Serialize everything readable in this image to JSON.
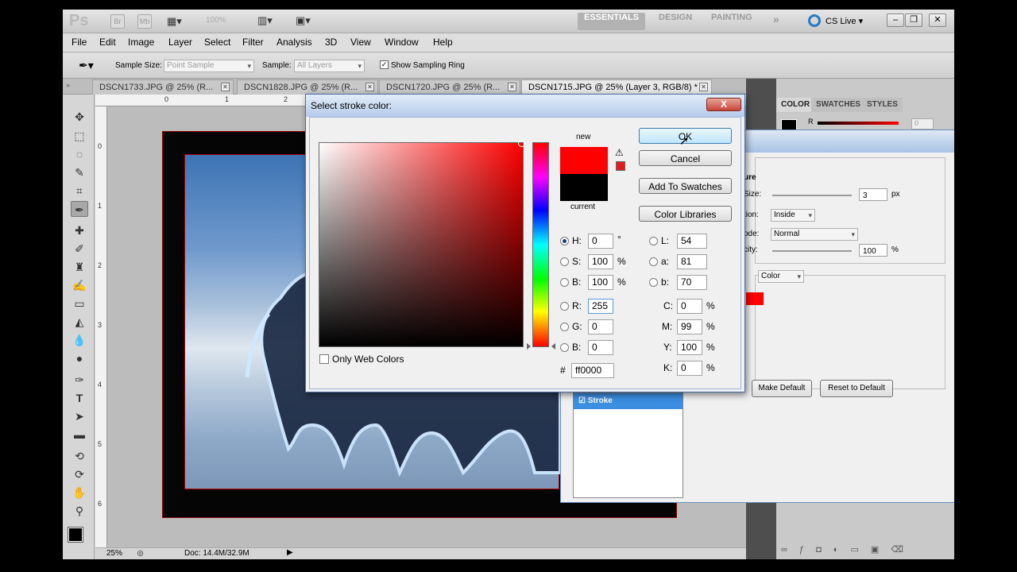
{
  "appbar": {
    "logo": "Ps",
    "br": "Br",
    "mb": "Mb",
    "zoom": "100%",
    "workspaces": [
      "ESSENTIALS",
      "DESIGN",
      "PAINTING"
    ],
    "more": "»",
    "cslive": "CS Live"
  },
  "menu": [
    "File",
    "Edit",
    "Image",
    "Layer",
    "Select",
    "Filter",
    "Analysis",
    "3D",
    "View",
    "Window",
    "Help"
  ],
  "options": {
    "sample_size_label": "Sample Size:",
    "sample_size_value": "Point Sample",
    "sample_label": "Sample:",
    "sample_value": "All Layers",
    "show_ring_label": "Show Sampling Ring"
  },
  "tabs": [
    {
      "label": "DSCN1733.JPG @ 25% (R..."
    },
    {
      "label": "DSCN1828.JPG @ 25% (R..."
    },
    {
      "label": "DSCN1720.JPG @ 25% (R..."
    },
    {
      "label": "DSCN1715.JPG @ 25% (Layer 3, RGB/8) *"
    }
  ],
  "rulers": {
    "h": [
      "0",
      "1",
      "2"
    ],
    "v": [
      "0",
      "1",
      "2",
      "3",
      "4",
      "5",
      "6"
    ]
  },
  "status": {
    "zoom": "25%",
    "doc": "Doc: 14.4M/32.9M"
  },
  "panels": {
    "tabs": [
      "COLOR",
      "SWATCHES",
      "STYLES"
    ],
    "r_label": "R",
    "r_value": "0"
  },
  "layer_style": {
    "section": "ure",
    "size_label": "Size:",
    "size_value": "3",
    "size_unit": "px",
    "position_label": "tion:",
    "position_value": "Inside",
    "mode_label": "ode:",
    "mode_value": "Normal",
    "opacity_label": "city:",
    "opacity_value": "100",
    "opacity_unit": "%",
    "fill_type": "Color",
    "make_default": "Make Default",
    "reset_default": "Reset to Default",
    "stroke_item": "Stroke"
  },
  "picker": {
    "title": "Select stroke color:",
    "close": "X",
    "new_label": "new",
    "current_label": "current",
    "ok": "OK",
    "cancel": "Cancel",
    "add_swatches": "Add To Swatches",
    "color_libraries": "Color Libraries",
    "only_web": "Only Web Colors",
    "hsb": [
      {
        "label": "H:",
        "value": "0",
        "unit": "°"
      },
      {
        "label": "S:",
        "value": "100",
        "unit": "%"
      },
      {
        "label": "B:",
        "value": "100",
        "unit": "%"
      }
    ],
    "rgb": [
      {
        "label": "R:",
        "value": "255"
      },
      {
        "label": "G:",
        "value": "0"
      },
      {
        "label": "B:",
        "value": "0"
      }
    ],
    "lab": [
      {
        "label": "L:",
        "value": "54"
      },
      {
        "label": "a:",
        "value": "81"
      },
      {
        "label": "b:",
        "value": "70"
      }
    ],
    "cmyk": [
      {
        "label": "C:",
        "value": "0",
        "unit": "%"
      },
      {
        "label": "M:",
        "value": "99",
        "unit": "%"
      },
      {
        "label": "Y:",
        "value": "100",
        "unit": "%"
      },
      {
        "label": "K:",
        "value": "0",
        "unit": "%"
      }
    ],
    "hex_label": "#",
    "hex_value": "ff0000",
    "new_color": "#ff0000",
    "current_color": "#000000"
  }
}
